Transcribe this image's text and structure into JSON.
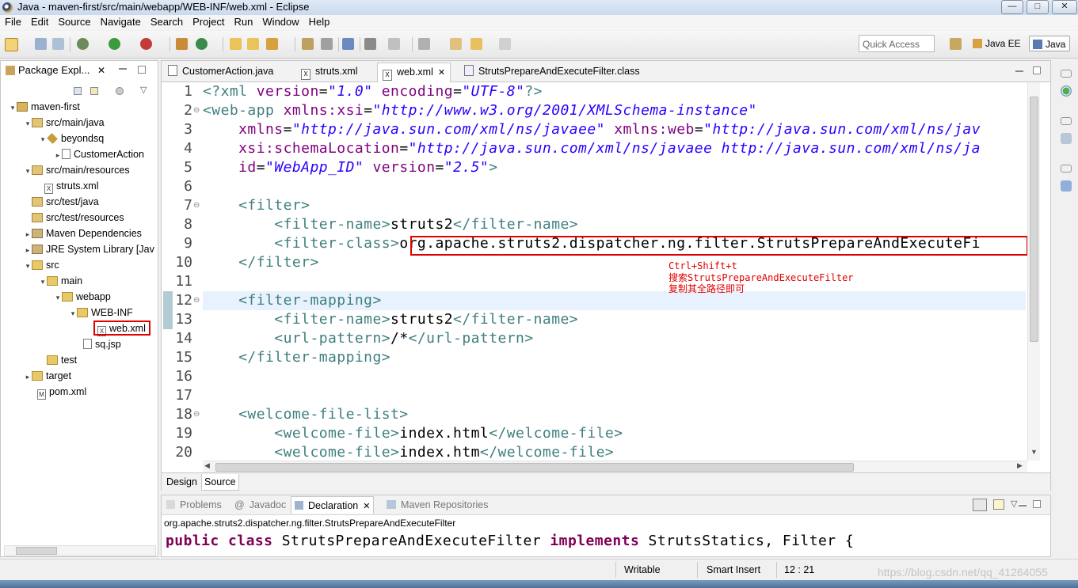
{
  "window": {
    "title": "Java - maven-first/src/main/webapp/WEB-INF/web.xml - Eclipse",
    "buttons": {
      "minimize": "—",
      "maximize": "□",
      "close": "✕"
    }
  },
  "menu": [
    "File",
    "Edit",
    "Source",
    "Navigate",
    "Search",
    "Project",
    "Run",
    "Window",
    "Help"
  ],
  "toolbar": {
    "quick_access_placeholder": "Quick Access",
    "perspectives": [
      "Java EE",
      "Java"
    ]
  },
  "package_explorer": {
    "tab_label": "Package Expl...",
    "tree": [
      {
        "label": "maven-first",
        "icon": "project-icon",
        "depth": 0,
        "twisty": "▾"
      },
      {
        "label": "src/main/java",
        "icon": "source-folder-icon",
        "depth": 1,
        "twisty": "▾"
      },
      {
        "label": "beyondsq",
        "icon": "package-icon",
        "depth": 2,
        "twisty": "▾"
      },
      {
        "label": "CustomerAction",
        "icon": "java-file-icon",
        "depth": 3,
        "twisty": "▸"
      },
      {
        "label": "src/main/resources",
        "icon": "source-folder-icon",
        "depth": 1,
        "twisty": "▾"
      },
      {
        "label": "struts.xml",
        "icon": "xml-file-icon",
        "depth": 2,
        "twisty": ""
      },
      {
        "label": "src/test/java",
        "icon": "source-folder-icon",
        "depth": 1,
        "twisty": ""
      },
      {
        "label": "src/test/resources",
        "icon": "source-folder-icon",
        "depth": 1,
        "twisty": ""
      },
      {
        "label": "Maven Dependencies",
        "icon": "library-icon",
        "depth": 1,
        "twisty": "▸"
      },
      {
        "label": "JRE System Library [Jav",
        "icon": "library-icon",
        "depth": 1,
        "twisty": "▸"
      },
      {
        "label": "src",
        "icon": "folder-icon",
        "depth": 1,
        "twisty": "▾"
      },
      {
        "label": "main",
        "icon": "folder-icon",
        "depth": 2,
        "twisty": "▾"
      },
      {
        "label": "webapp",
        "icon": "folder-icon",
        "depth": 3,
        "twisty": "▾"
      },
      {
        "label": "WEB-INF",
        "icon": "folder-icon",
        "depth": 4,
        "twisty": "▾"
      },
      {
        "label": "web.xml",
        "icon": "xml-file-icon",
        "depth": 5,
        "twisty": ""
      },
      {
        "label": "sq.jsp",
        "icon": "jsp-file-icon",
        "depth": 4,
        "twisty": ""
      },
      {
        "label": "test",
        "icon": "folder-icon",
        "depth": 2,
        "twisty": ""
      },
      {
        "label": "target",
        "icon": "folder-icon",
        "depth": 1,
        "twisty": "▸"
      },
      {
        "label": "pom.xml",
        "icon": "xml-file-icon",
        "depth": 1,
        "twisty": ""
      }
    ]
  },
  "editor": {
    "tabs": [
      {
        "label": "CustomerAction.java",
        "active": false
      },
      {
        "label": "struts.xml",
        "active": false
      },
      {
        "label": "web.xml",
        "active": true
      },
      {
        "label": "StrutsPrepareAndExecuteFilter.class",
        "active": false
      }
    ],
    "line_numbers": [
      "1",
      "2",
      "3",
      "4",
      "5",
      "6",
      "7",
      "8",
      "9",
      "10",
      "11",
      "12",
      "13",
      "14",
      "15",
      "16",
      "17",
      "18",
      "19",
      "20"
    ],
    "lines": {
      "l1_a": "<?xml ",
      "l1_b": "version",
      "l1_c": "=",
      "l1_d": "\"1.0\"",
      "l1_e": " encoding",
      "l1_f": "=",
      "l1_g": "\"UTF-8\"",
      "l1_h": "?>",
      "l2_a": "<web-app ",
      "l2_b": "xmlns:xsi",
      "l2_c": "=",
      "l2_d": "\"http://www.w3.org/2001/XMLSchema-instance\"",
      "l3_a": "    xmlns",
      "l3_b": "=",
      "l3_c": "\"http://java.sun.com/xml/ns/javaee\"",
      "l3_d": " xmlns:web",
      "l3_e": "=",
      "l3_f": "\"http://java.sun.com/xml/ns/jav",
      "l4_a": "    xsi:schemaLocation",
      "l4_b": "=",
      "l4_c": "\"http://java.sun.com/xml/ns/javaee http://java.sun.com/xml/ns/ja",
      "l5_a": "    id",
      "l5_b": "=",
      "l5_c": "\"WebApp_ID\"",
      "l5_d": " version",
      "l5_e": "=",
      "l5_f": "\"2.5\"",
      "l5_g": ">",
      "l7": "    <filter>",
      "l8_a": "        <filter-name>",
      "l8_b": "struts2",
      "l8_c": "</filter-name>",
      "l9_a": "        <filter-class>",
      "l9_b": "org.apache.struts2.dispatcher.ng.filter.StrutsPrepareAndExecuteFi",
      "l10": "    </filter>",
      "l12": "    <filter-mapping>",
      "l13_a": "        <filter-name>",
      "l13_b": "struts2",
      "l13_c": "</filter-name>",
      "l14_a": "        <url-pattern>",
      "l14_b": "/*",
      "l14_c": "</url-pattern>",
      "l15": "    </filter-mapping>",
      "l18": "    <welcome-file-list>",
      "l19_a": "        <welcome-file>",
      "l19_b": "index.html",
      "l19_c": "</welcome-file>",
      "l20_a": "        <welcome-file>",
      "l20_b": "index.htm",
      "l20_c": "</welcome-file>"
    },
    "annotation": [
      "Ctrl+Shift+t",
      "搜索StrutsPrepareAndExecuteFilter",
      "复制其全路径即可"
    ],
    "bottom_tabs": [
      {
        "label": "Design",
        "active": false
      },
      {
        "label": "Source",
        "active": true
      }
    ]
  },
  "bottom_panel": {
    "tabs": [
      {
        "label": "Problems",
        "active": false
      },
      {
        "label": "Javadoc",
        "active": false
      },
      {
        "label": "Declaration",
        "active": true
      },
      {
        "label": "Maven Repositories",
        "active": false
      }
    ],
    "declaration_path": "org.apache.struts2.dispatcher.ng.filter.StrutsPrepareAndExecuteFilter",
    "code": {
      "k1": "public",
      "k2": " class",
      "t1": " StrutsPrepareAndExecuteFilter ",
      "k3": "implements",
      "t2": " StrutsStatics, Filter {"
    }
  },
  "status_bar": {
    "mode": "Writable",
    "insert": "Smart Insert",
    "position": "12 : 21",
    "watermark": "https://blog.csdn.net/qq_41264055"
  },
  "colors": {
    "tag": "#3f7f7f",
    "attribute": "#7f007f",
    "value": "#2a00ff",
    "keyword": "#7f0055",
    "highlight_box": "#e00000",
    "current_line": "#e8f2fe"
  }
}
